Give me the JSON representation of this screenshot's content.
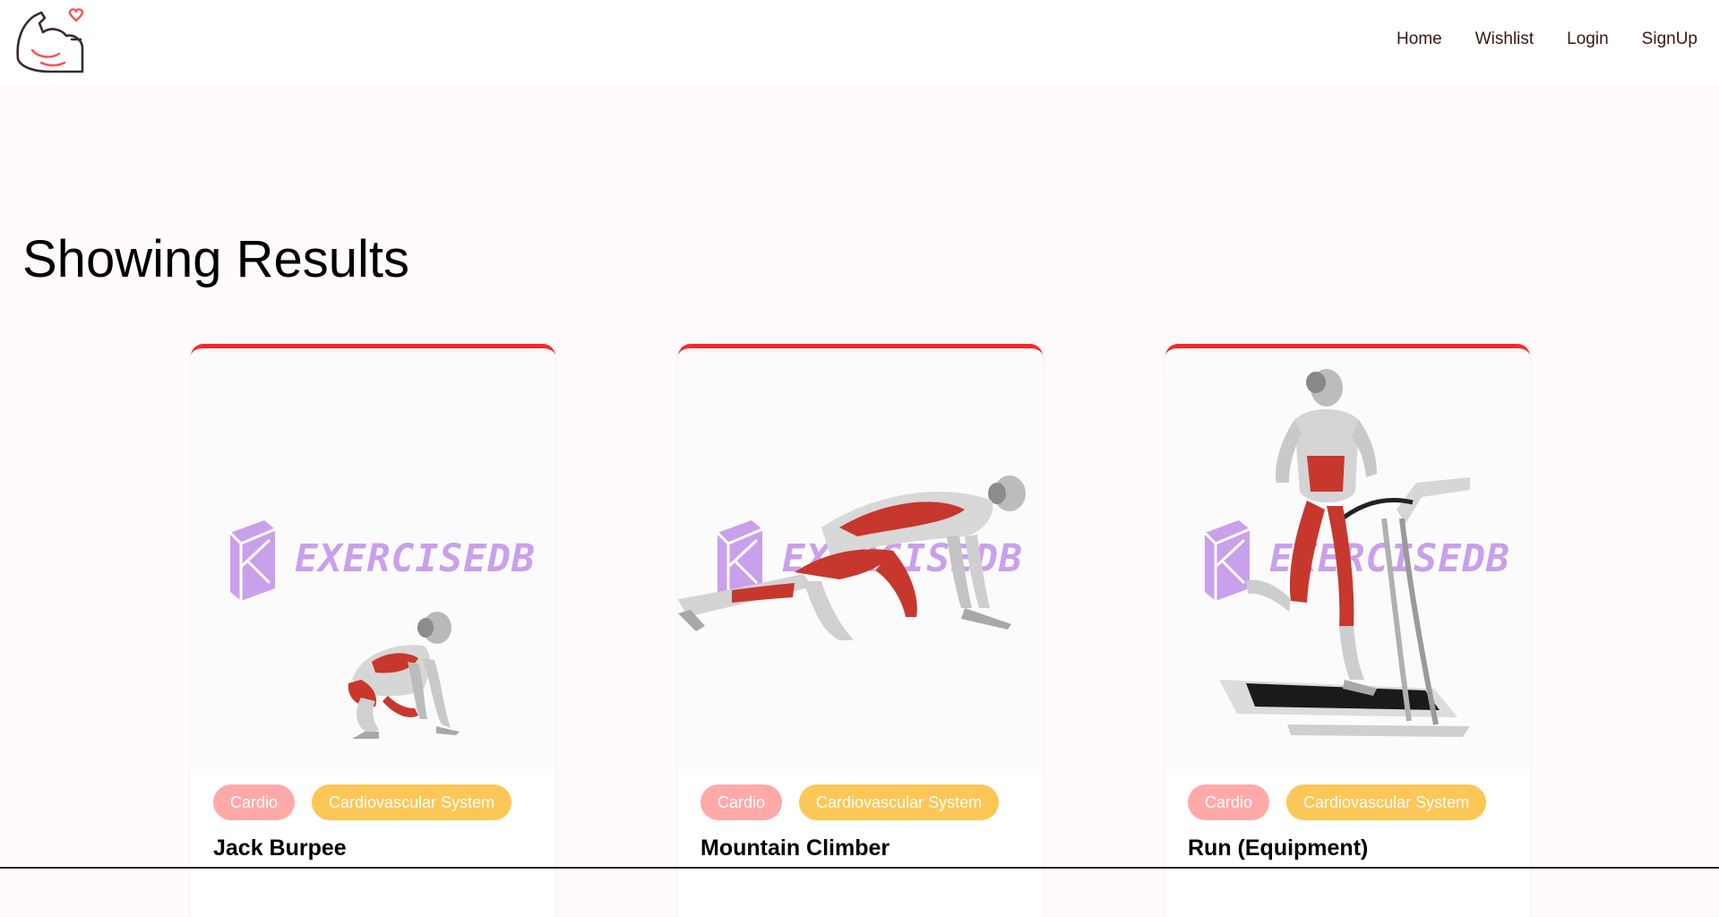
{
  "nav": {
    "logo_icon": "flexed-arm-heart-icon",
    "links": [
      "Home",
      "Wishlist",
      "Login",
      "SignUp"
    ]
  },
  "main": {
    "title": "Showing Results"
  },
  "cards": [
    {
      "name": "Jack Burpee",
      "tags": [
        "Cardio",
        "Cardiovascular System"
      ],
      "watermark": "EXERCISEDB"
    },
    {
      "name": "Mountain Climber",
      "tags": [
        "Cardio",
        "Cardiovascular System"
      ],
      "watermark": "EXERCISEDB"
    },
    {
      "name": "Run (Equipment)",
      "tags": [
        "Cardio",
        "Cardiovascular System"
      ],
      "watermark": "EXERCISEDB"
    }
  ],
  "colors": {
    "accent": "#ff2625",
    "bodypart_tag": "#ffa9a9",
    "target_tag": "#fcc757",
    "watermark": "#c9a0ec",
    "background": "#fffafb"
  }
}
